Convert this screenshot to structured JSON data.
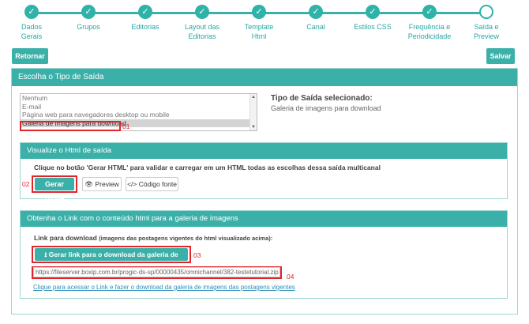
{
  "stepper": {
    "steps": [
      {
        "label": "Dados Gerais",
        "state": "done"
      },
      {
        "label": "Grupos",
        "state": "done"
      },
      {
        "label": "Editorias",
        "state": "done"
      },
      {
        "label": "Layout das Editorias",
        "state": "done"
      },
      {
        "label": "Template Html",
        "state": "done"
      },
      {
        "label": "Canal",
        "state": "done"
      },
      {
        "label": "Estilos CSS",
        "state": "done"
      },
      {
        "label": "Frequência e Periodicidade",
        "state": "done"
      },
      {
        "label": "Saída e Preview",
        "state": "current"
      }
    ],
    "check_glyph": "✓"
  },
  "toolbar": {
    "back_label": "Retornar",
    "save_label": "Salvar"
  },
  "output_type": {
    "title": "Escolha o Tipo de Saída",
    "options": [
      "Nenhum",
      "E-mail",
      "Página web para navegadores desktop ou mobile",
      "Galeria de imagens para download"
    ],
    "selected_index": 3,
    "selected_title": "Tipo de Saída selecionado:",
    "selected_value": "Galeria de imagens para download",
    "marker": "01"
  },
  "html_output": {
    "title": "Visualize o Html de saída",
    "instruction": "Clique no botão 'Gerar HTML' para validar e carregar em um HTML todas as escolhas dessa saída multicanal",
    "generate_label": "Gerar HTML",
    "preview_label": "Preview",
    "source_label": "Código fonte",
    "marker": "02"
  },
  "link_output": {
    "title": "Obtenha o Link com o conteúdo html para a galeria de imagens",
    "download_label": "Link para download",
    "download_note": "(imagens das postagens vigentes do html visualizado acima):",
    "generate_link_label": "Gerar link para o download da galeria de imagens",
    "url": "https://fileserver.boxip.com.br/progic-ds-sp/00000435/omnichannel/382-testetutorial.zip",
    "access_link": "Clique para acessar o Link e fazer o download da galeria de imagens das postagens vigentes",
    "marker_button": "03",
    "marker_url": "04"
  },
  "colors": {
    "accent": "#3bb0a8",
    "highlight": "#e0262b"
  }
}
